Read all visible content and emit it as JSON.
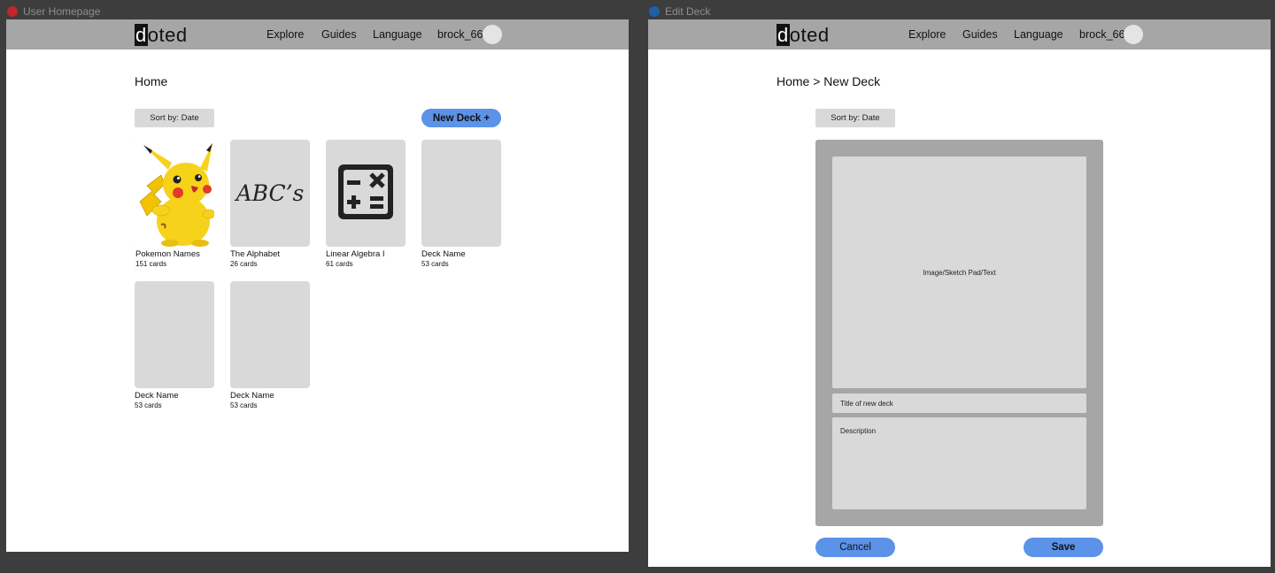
{
  "frames": {
    "homepage": {
      "label": "User Homepage",
      "dot_color": "#c0262b",
      "nav": {
        "logo_first": "d",
        "logo_rest": "oted",
        "items": [
          "Explore",
          "Guides",
          "Language"
        ],
        "username": "brock_66"
      },
      "breadcrumb": "Home",
      "sort_label": "Sort by: Date",
      "new_deck_label": "New Deck +",
      "decks": [
        {
          "name": "Pokemon Names",
          "count": "151 cards",
          "thumb": "pikachu-image"
        },
        {
          "name": "The Alphabet",
          "count": "26 cards",
          "thumb": "abc-handwriting",
          "thumb_text": "ABC’s"
        },
        {
          "name": "Linear Algebra I",
          "count": "61 cards",
          "thumb": "calculator-icon"
        },
        {
          "name": "Deck Name",
          "count": "53 cards",
          "thumb": "empty"
        },
        {
          "name": "Deck Name",
          "count": "53 cards",
          "thumb": "empty"
        },
        {
          "name": "Deck Name",
          "count": "53 cards",
          "thumb": "empty"
        }
      ]
    },
    "edit_deck": {
      "label": "Edit Deck",
      "dot_color": "#1f5fa8",
      "nav": {
        "logo_first": "d",
        "logo_rest": "oted",
        "items": [
          "Explore",
          "Guides",
          "Language"
        ],
        "username": "brock_66"
      },
      "breadcrumb": "Home > New Deck",
      "sort_label": "Sort by: Date",
      "image_pad_label": "Image/Sketch Pad/Text",
      "title_placeholder": "Title of new deck",
      "description_placeholder": "Description",
      "cancel_label": "Cancel",
      "save_label": "Save"
    }
  },
  "colors": {
    "background": "#3d3d3d",
    "navbar": "#a6a6a6",
    "card": "#d9d9d9",
    "accent_button": "#5b93e8"
  }
}
